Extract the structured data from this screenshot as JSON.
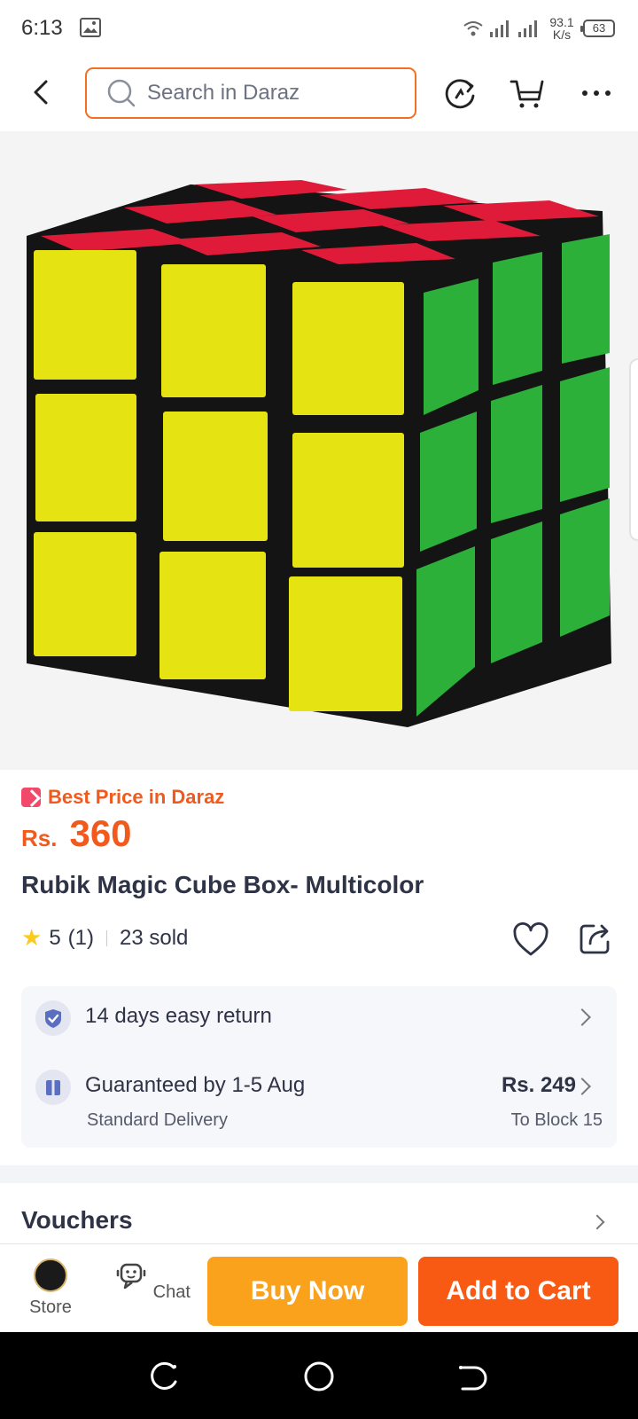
{
  "status_bar": {
    "time": "6:13",
    "netspeed_value": "93.1",
    "netspeed_unit": "K/s",
    "battery": "63"
  },
  "header": {
    "search_placeholder": "Search in Daraz",
    "accent_color": "#f36f21"
  },
  "product": {
    "best_price_label": "Best Price in Daraz",
    "currency": "Rs.",
    "price": "360",
    "title": "Rubik Magic Cube Box- Multicolor",
    "rating": "5",
    "rating_count": "(1)",
    "sold": "23 sold"
  },
  "services": {
    "return_label": "14 days easy return",
    "delivery_label": "Guaranteed by 1-5 Aug",
    "delivery_type": "Standard Delivery",
    "delivery_fee": "Rs. 249",
    "delivery_location": "To Block 15"
  },
  "vouchers": {
    "title": "Vouchers"
  },
  "action_bar": {
    "store_label": "Store",
    "chat_label": "Chat",
    "buy_now": "Buy Now",
    "add_to_cart": "Add to Cart",
    "buy_color": "#fba21c",
    "cart_color": "#f85a14"
  }
}
